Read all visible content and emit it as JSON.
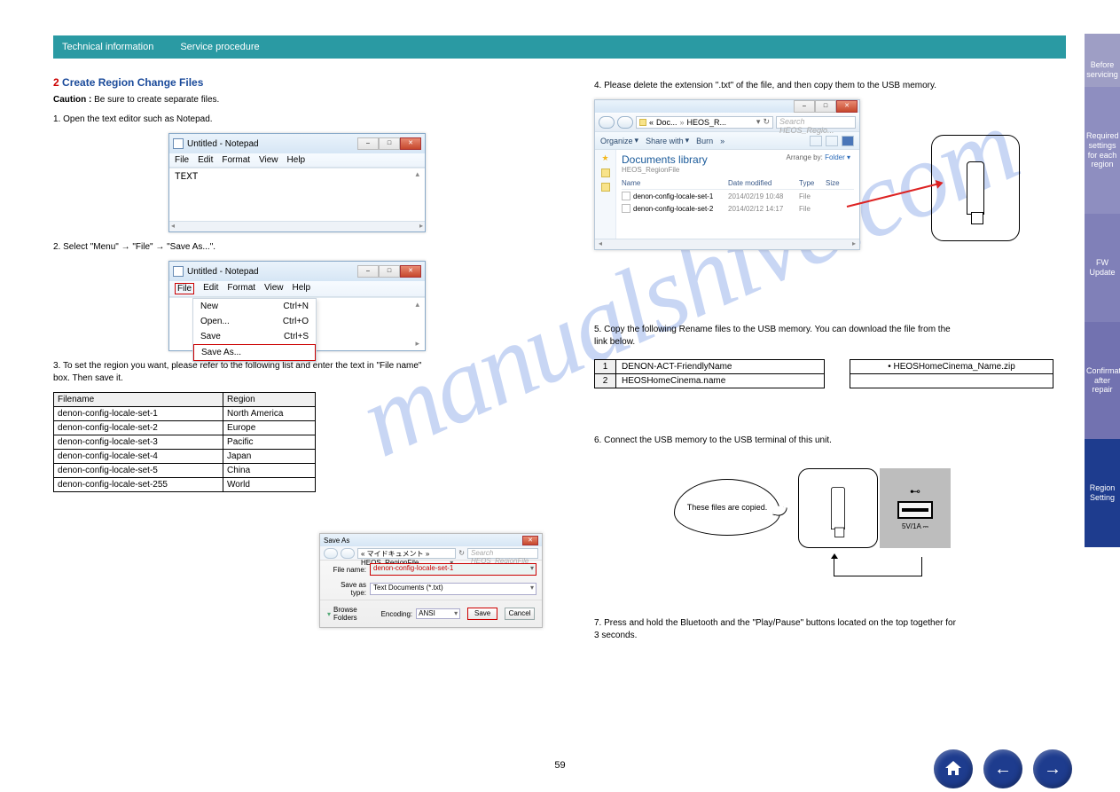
{
  "watermark": "manualshive.com",
  "header": {
    "tech": "Technical information",
    "serv": "Service procedure"
  },
  "sidebar": {
    "t1": "Before servicing",
    "t2": "Required settings for each region",
    "t3": "FW Update",
    "t4": "Confirmation after repair",
    "t5": "Region Setting"
  },
  "left": {
    "section_num": "2",
    "section_title": "Create Region Change Files",
    "caution_label": "Caution :",
    "caution_text": "Be sure to create separate files.",
    "step1": "1. Open the text editor such as Notepad.",
    "step2": "2. Select \"Menu\" → \"File\" → \"Save As...\".",
    "np_title": "Untitled - Notepad",
    "np_menu": {
      "file": "File",
      "edit": "Edit",
      "format": "Format",
      "view": "View",
      "help": "Help"
    },
    "np_text": "TEXT",
    "sub": {
      "new": "New",
      "new_k": "Ctrl+N",
      "open": "Open...",
      "open_k": "Ctrl+O",
      "save": "Save",
      "save_k": "Ctrl+S",
      "saveas": "Save As..."
    },
    "step3_a": "3. To set the region you want, please refer to the following list and enter the text in \"File name\"",
    "step3_b": "box. Then save it.",
    "region_hdr1": "Filename",
    "region_hdr2": "Region",
    "regions": [
      {
        "f": "denon-config-locale-set-1",
        "r": "North America"
      },
      {
        "f": "denon-config-locale-set-2",
        "r": "Europe"
      },
      {
        "f": "denon-config-locale-set-3",
        "r": "Pacific"
      },
      {
        "f": "denon-config-locale-set-4",
        "r": "Japan"
      },
      {
        "f": "denon-config-locale-set-5",
        "r": "China"
      },
      {
        "f": "denon-config-locale-set-255",
        "r": "World"
      }
    ],
    "saveas": {
      "title": "Save As",
      "addr": "« マイドキュメント » HEOS_RegionFile",
      "search": "Search HEOS_RegionFile",
      "filename_lbl": "File name:",
      "filename_val": "denon-config-locale-set-1",
      "type_lbl": "Save as type:",
      "type_val": "Text Documents (*.txt)",
      "browse": "Browse Folders",
      "enc_lbl": "Encoding:",
      "enc_val": "ANSI",
      "save": "Save",
      "cancel": "Cancel"
    }
  },
  "right": {
    "step4": "4. Please delete the extension \".txt\" of the file, and then copy them to the USB memory.",
    "explorer": {
      "addr_parts": [
        "«",
        "Doc...",
        "»",
        "HEOS_R..."
      ],
      "search": "Search HEOS_Regio...",
      "tools": {
        "org": "Organize",
        "share": "Share with",
        "burn": "Burn",
        "more": "»"
      },
      "lib": "Documents library",
      "lib_sub": "HEOS_RegionFile",
      "arrange_lbl": "Arrange by:",
      "arrange_val": "Folder ▾",
      "cols": {
        "name": "Name",
        "date": "Date modified",
        "type": "Type",
        "size": "Size"
      },
      "rows": [
        {
          "n": "denon-config-locale-set-1",
          "d": "2014/02/19 10:48",
          "t": "File"
        },
        {
          "n": "denon-config-locale-set-2",
          "d": "2014/02/12 14:17",
          "t": "File"
        }
      ]
    },
    "step5_a": "5. Copy the following Rename files to the USB memory. You can download the file from the",
    "step5_b": "link below.",
    "files": [
      {
        "n": "1",
        "name": "DENON-ACT-FriendlyName"
      },
      {
        "n": "2",
        "name": "HEOSHomeCinema.name"
      }
    ],
    "file_link": "• HEOSHomeCinema_Name.zip",
    "step6": "6. Connect the USB memory to the USB terminal of this unit.",
    "speech": "These files are copied.",
    "port_sym": "⊷",
    "port_label": "5V/1A ⎓",
    "step7": "7. Press and hold the Bluetooth and the \"Play/Pause\" buttons located on the top together for",
    "step7b": "3 seconds."
  },
  "footer": {
    "page": "59"
  }
}
